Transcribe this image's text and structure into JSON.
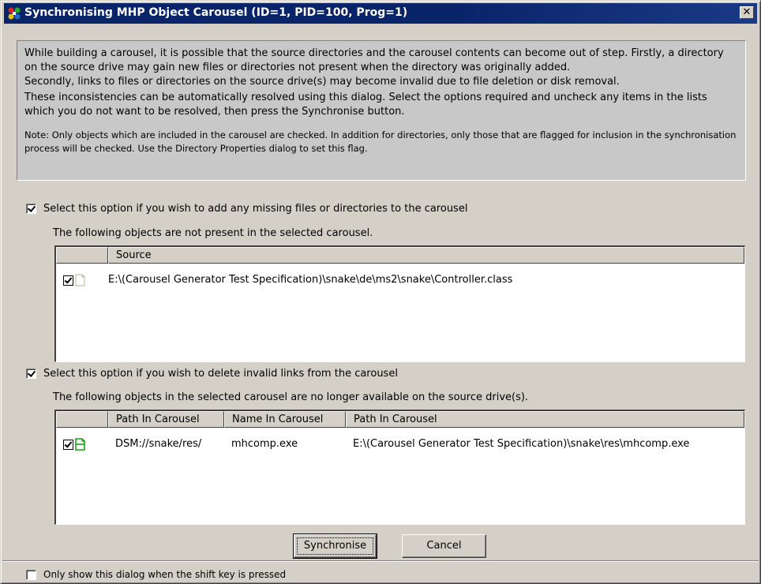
{
  "window": {
    "title": "Synchronising MHP Object Carousel (ID=1, PID=100, Prog=1)",
    "close_glyph": "✕"
  },
  "info": {
    "para1": "While building a carousel, it is possible that the source directories and the carousel contents can become out of step. Firstly, a directory on the source drive may gain new files or directories not present when the directory was originally added.",
    "para2": "Secondly, links to files or directories on the source drive(s) may become invalid due to file deletion or disk removal.",
    "para3": "These inconsistencies can be automatically resolved using this dialog. Select the options required and uncheck any items in the lists which you do not want to be resolved, then press the Synchronise button.",
    "note": "Note: Only objects which are included in the carousel are checked. In addition for directories, only those that are flagged for inclusion in the synchronisation process will be checked. Use the Directory Properties dialog to set this flag."
  },
  "add_section": {
    "checked": true,
    "option_label": "Select this option if you wish to add any missing files or directories to the carousel",
    "sublabel": "The following objects are not present in the selected carousel.",
    "columns": [
      "",
      "Source"
    ],
    "rows": [
      {
        "checked": true,
        "icon": "file-icon",
        "source": "E:\\(Carousel Generator Test Specification)\\snake\\de\\ms2\\snake\\Controller.class"
      }
    ]
  },
  "delete_section": {
    "checked": true,
    "option_label": "Select this option if you wish to delete invalid links from the carousel",
    "sublabel": "The following objects in the selected carousel are no longer available on the source drive(s).",
    "columns": [
      "",
      "Path In Carousel",
      "Name In Carousel",
      "Path In Carousel"
    ],
    "rows": [
      {
        "checked": true,
        "icon": "broken-link-file-icon",
        "path": "DSM://snake/res/",
        "name": "mhcomp.exe",
        "source_path": "E:\\(Carousel Generator Test Specification)\\snake\\res\\mhcomp.exe"
      }
    ]
  },
  "buttons": {
    "synchronise": "Synchronise",
    "cancel": "Cancel"
  },
  "footer": {
    "checked": false,
    "label": "Only show this dialog when the shift key is pressed"
  },
  "colors": {
    "title_bar": "#0a246a",
    "face": "#d4d0c8",
    "info_panel": "#c8c8c8"
  }
}
